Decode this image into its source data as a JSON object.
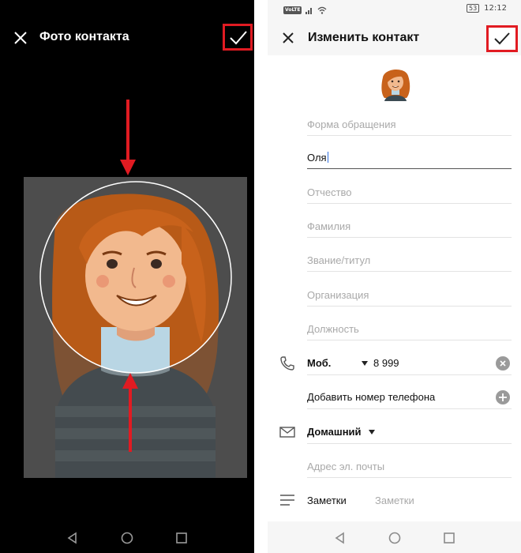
{
  "left_screen": {
    "title": "Фото контакта",
    "icons": {
      "close": "close-icon",
      "confirm": "check-icon"
    },
    "annotation_color": "#e11b22",
    "crop_background": "#4d4d4d"
  },
  "right_screen": {
    "status_bar": {
      "volte": "VoLTE",
      "battery": "53",
      "time": "12:12"
    },
    "title": "Изменить контакт",
    "fields": {
      "prefix_placeholder": "Форма обращения",
      "first_name_value": "Оля",
      "middle_name_placeholder": "Отчество",
      "last_name_placeholder": "Фамилия",
      "title_placeholder": "Звание/титул",
      "organization_placeholder": "Организация",
      "position_placeholder": "Должность"
    },
    "phone": {
      "type_label": "Моб.",
      "number": "8 999",
      "add_label": "Добавить номер телефона"
    },
    "email": {
      "type_label": "Домашний",
      "placeholder": "Адрес эл. почты"
    },
    "notes": {
      "label": "Заметки",
      "placeholder": "Заметки"
    }
  },
  "navbar": {
    "icons": [
      "back-icon",
      "home-icon",
      "recents-icon"
    ]
  }
}
